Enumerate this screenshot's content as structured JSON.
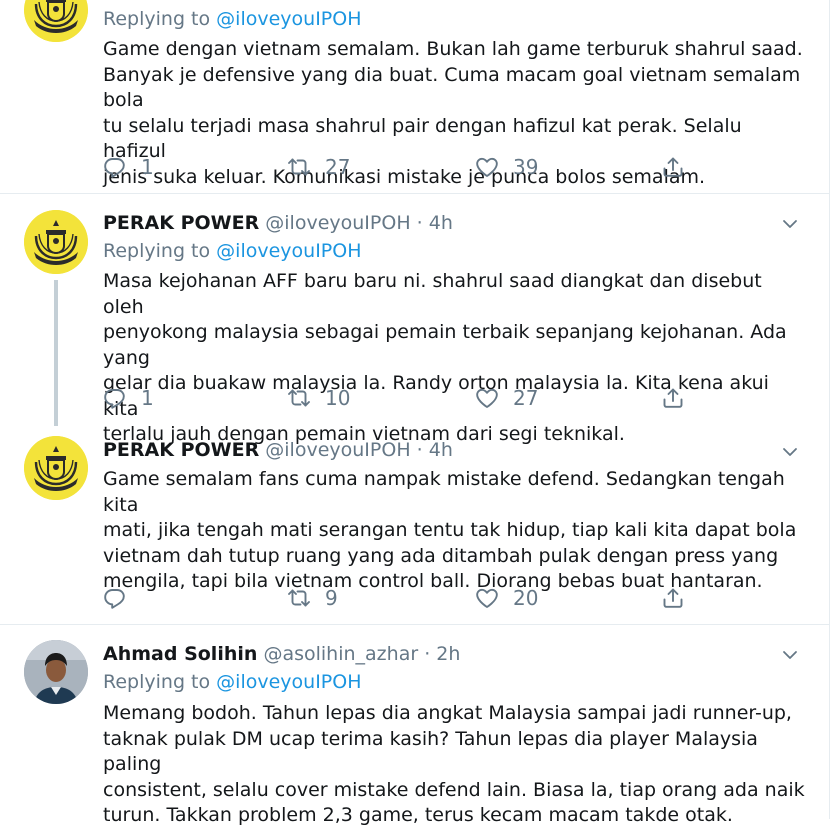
{
  "tweets": [
    {
      "name": "",
      "handle": "",
      "replying_prefix": "Replying to",
      "replying_to": "@iloveyouIPOH",
      "text": "Game dengan vietnam semalam. Bukan lah game terburuk shahrul saad.\nBanyak je defensive yang dia buat. Cuma macam goal vietnam semalam bola\ntu selalu terjadi masa shahrul pair dengan hafizul kat perak. Selalu hafizul\njenis suka keluar. Komunikasi mistake je punca bolos semalam.",
      "replies": "1",
      "retweets": "27",
      "likes": "39"
    },
    {
      "name": "PERAK POWER",
      "handle": "@iloveyouIPOH · 4h",
      "replying_prefix": "Replying to",
      "replying_to": "@iloveyouIPOH",
      "text": "Masa kejohanan AFF baru baru ni. shahrul saad diangkat dan disebut oleh\npenyokong malaysia sebagai pemain terbaik sepanjang kejohanan. Ada yang\ngelar dia buakaw malaysia la. Randy orton malaysia la. Kita kena akui kita\nterlalu jauh dengan pemain vietnam dari segi teknikal.",
      "replies": "1",
      "retweets": "10",
      "likes": "27"
    },
    {
      "name": "PERAK POWER",
      "handle": "@iloveyouIPOH · 4h",
      "text": "Game semalam fans cuma nampak mistake defend. Sedangkan tengah kita\nmati, jika tengah mati serangan tentu tak hidup, tiap kali kita dapat bola\nvietnam dah tutup ruang yang ada ditambah pulak dengan press yang\nmengila, tapi bila vietnam control ball. Diorang bebas buat hantaran.",
      "replies": "",
      "retweets": "9",
      "likes": "20"
    },
    {
      "name": "Ahmad Solihin",
      "handle": "@asolihin_azhar · 2h",
      "replying_prefix": "Replying to",
      "replying_to": "@iloveyouIPOH",
      "text": "Memang bodoh. Tahun lepas dia angkat Malaysia sampai jadi runner-up,\ntaknak pulak DM ucap terima kasih? Tahun lepas dia player Malaysia paling\nconsistent, selalu cover mistake defend lain. Biasa la, tiap orang ada naik\nturun. Takkan problem 2,3 game, terus kecam macam takde otak."
    }
  ],
  "icons": {
    "reply": "reply-icon",
    "retweet": "retweet-icon",
    "like": "heart-icon",
    "share": "share-icon",
    "more": "chevron-down-icon"
  },
  "colors": {
    "mention": "#1b95e0",
    "secondary_text": "#657786",
    "thread_line": "#c4cfd6",
    "avatar_yellow": "#f3e33a"
  }
}
